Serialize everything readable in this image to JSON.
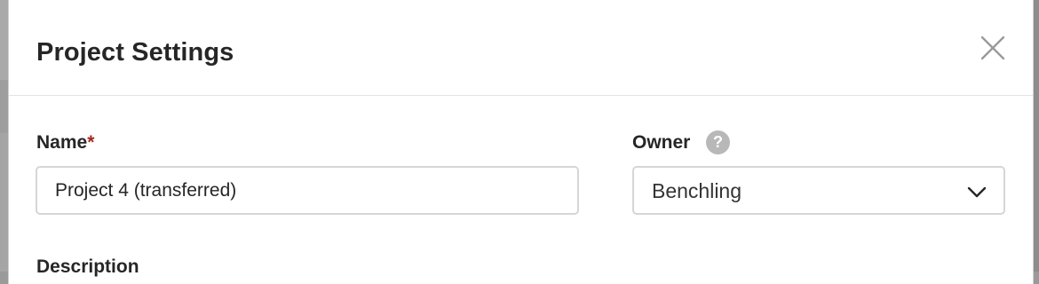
{
  "modal": {
    "title": "Project Settings"
  },
  "form": {
    "name": {
      "label": "Name",
      "required_marker": "*",
      "value": "Project 4 (transferred)"
    },
    "owner": {
      "label": "Owner",
      "help_glyph": "?",
      "selected": "Benchling"
    },
    "description": {
      "label": "Description"
    }
  },
  "icons": {
    "close": "close-icon",
    "help": "question-circle-icon",
    "dropdown": "chevron-down-icon"
  },
  "colors": {
    "required": "#a3271b",
    "input_border": "#d6d6d6",
    "title_text": "#262626"
  }
}
